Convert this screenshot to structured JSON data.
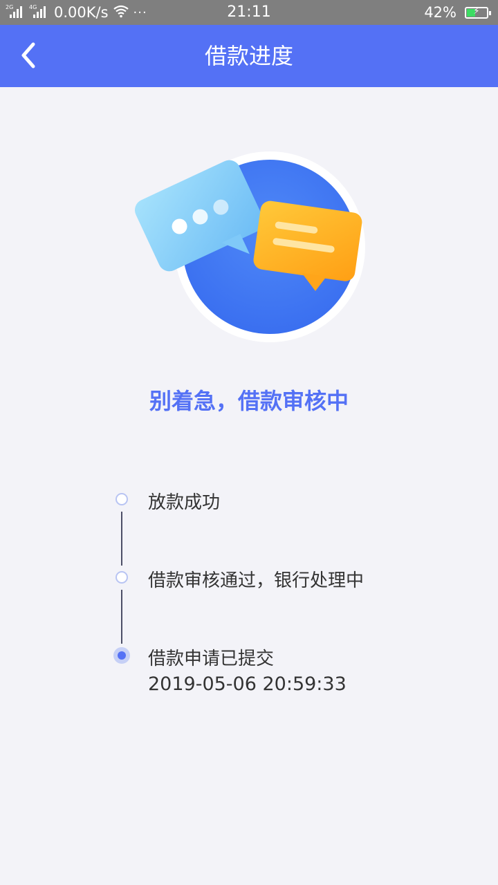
{
  "status_bar": {
    "signal1_tag": "2G",
    "signal2_tag": "4G",
    "net_speed": "0.00K/s",
    "more_dots": "···",
    "time": "21:11",
    "battery_percent": "42%",
    "battery_level": 0.42,
    "icons": [
      "signal-icon",
      "wifi-icon",
      "battery-charging-icon"
    ]
  },
  "nav": {
    "title": "借款进度",
    "back_icon": "chevron-left-icon"
  },
  "headline": "别着急，借款审核中",
  "timeline": {
    "steps": [
      {
        "label": "放款成功",
        "state": "pending"
      },
      {
        "label": "借款审核通过，银行处理中",
        "state": "pending"
      },
      {
        "label": "借款申请已提交",
        "time": "2019-05-06 20:59:33",
        "state": "current"
      }
    ]
  },
  "colors": {
    "primary": "#5471f5",
    "status_bar": "#7f7f7f",
    "background": "#f3f3f8",
    "bubble_orange": "#ffb11f",
    "bubble_blue": "#8fd3fb",
    "circle_blue": "#3f78f2"
  }
}
